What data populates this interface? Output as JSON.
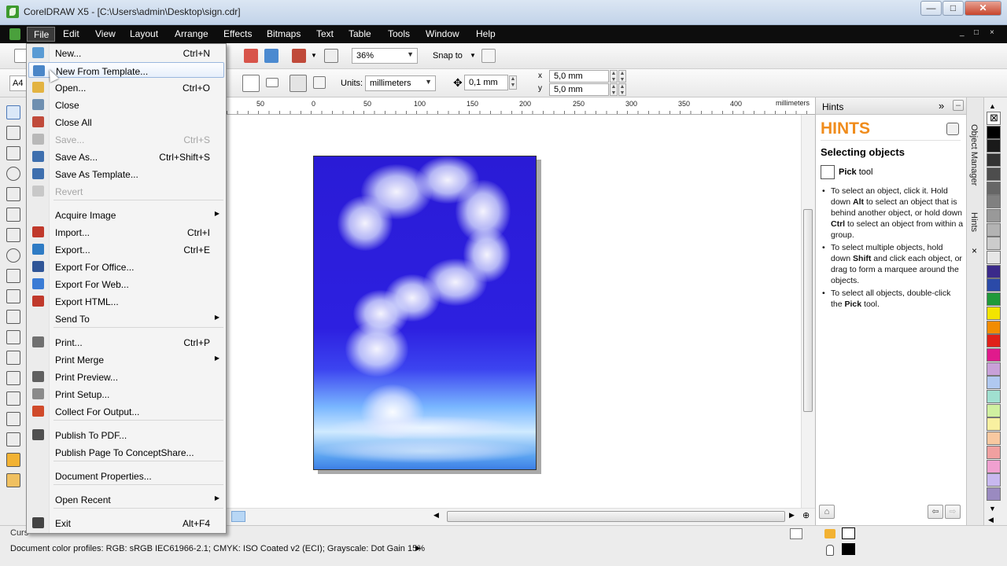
{
  "window": {
    "title": "CorelDRAW X5 - [C:\\Users\\admin\\Desktop\\sign.cdr]",
    "minimize": "—",
    "maximize": "□",
    "close": "✕"
  },
  "menubar": {
    "items": [
      "File",
      "Edit",
      "View",
      "Layout",
      "Arrange",
      "Effects",
      "Bitmaps",
      "Text",
      "Table",
      "Tools",
      "Window",
      "Help"
    ],
    "mdi": [
      "_",
      "□",
      "×"
    ]
  },
  "toolbar1": {
    "zoom": "36%",
    "snap_to": "Snap to"
  },
  "toolbar2": {
    "paper": "A4",
    "units_label": "Units:",
    "units_value": "millimeters",
    "nudge": "0,1 mm",
    "dup_x": "5,0 mm",
    "dup_y": "5,0 mm",
    "x_icon": "x",
    "y_icon": "y"
  },
  "ruler": {
    "ticks": [
      "50",
      "0",
      "50",
      "100",
      "150",
      "200",
      "250",
      "300",
      "350",
      "400"
    ],
    "unit": "millimeters"
  },
  "file_menu": [
    {
      "label": "New...",
      "shortcut": "Ctrl+N",
      "icon": "new-document-icon",
      "color": "#5a9bd4"
    },
    {
      "label": "New From Template...",
      "shortcut": "",
      "icon": "template-icon",
      "color": "#4a86c8",
      "highlight": true
    },
    {
      "label": "Open...",
      "shortcut": "Ctrl+O",
      "icon": "open-folder-icon",
      "color": "#e3b341"
    },
    {
      "label": "Close",
      "shortcut": "",
      "icon": "close-document-icon",
      "color": "#6f8fb0"
    },
    {
      "label": "Close All",
      "shortcut": "",
      "icon": "close-all-icon",
      "color": "#c04a3a"
    },
    {
      "label": "Save...",
      "shortcut": "Ctrl+S",
      "icon": "save-icon",
      "color": "#b8b8b8",
      "disabled": true
    },
    {
      "label": "Save As...",
      "shortcut": "Ctrl+Shift+S",
      "icon": "save-as-icon",
      "color": "#3e6fae"
    },
    {
      "label": "Save As Template...",
      "shortcut": "",
      "icon": "save-template-icon",
      "color": "#3e6fae"
    },
    {
      "label": "Revert",
      "shortcut": "",
      "icon": "revert-icon",
      "color": "#c8c8c8",
      "disabled": true
    },
    {
      "label": "Acquire Image",
      "shortcut": "",
      "icon": "",
      "submenu": true
    },
    {
      "label": "Import...",
      "shortcut": "Ctrl+I",
      "icon": "import-icon",
      "color": "#c0392b"
    },
    {
      "label": "Export...",
      "shortcut": "Ctrl+E",
      "icon": "export-icon",
      "color": "#2e7bc4"
    },
    {
      "label": "Export For Office...",
      "shortcut": "",
      "icon": "export-office-icon",
      "color": "#2f5597"
    },
    {
      "label": "Export For Web...",
      "shortcut": "",
      "icon": "export-web-icon",
      "color": "#3a7bd5"
    },
    {
      "label": "Export HTML...",
      "shortcut": "",
      "icon": "export-html-icon",
      "color": "#c0392b"
    },
    {
      "label": "Send To",
      "shortcut": "",
      "icon": "",
      "submenu": true
    },
    {
      "label": "Print...",
      "shortcut": "Ctrl+P",
      "icon": "print-icon",
      "color": "#707070"
    },
    {
      "label": "Print Merge",
      "shortcut": "",
      "icon": "",
      "submenu": true
    },
    {
      "label": "Print Preview...",
      "shortcut": "",
      "icon": "print-preview-icon",
      "color": "#606060"
    },
    {
      "label": "Print Setup...",
      "shortcut": "",
      "icon": "print-setup-icon",
      "color": "#8a8a8a"
    },
    {
      "label": "Collect For Output...",
      "shortcut": "",
      "icon": "collect-output-icon",
      "color": "#d04a2a"
    },
    {
      "label": "Publish To PDF...",
      "shortcut": "",
      "icon": "pdf-icon",
      "color": "#505050"
    },
    {
      "label": "Publish Page To ConceptShare...",
      "shortcut": "",
      "icon": ""
    },
    {
      "label": "Document Properties...",
      "shortcut": "",
      "icon": ""
    },
    {
      "label": "Open Recent",
      "shortcut": "",
      "icon": "",
      "submenu": true
    },
    {
      "label": "Exit",
      "shortcut": "Alt+F4",
      "icon": "exit-icon",
      "color": "#444444"
    }
  ],
  "hints": {
    "docker_title": "Hints",
    "logo": "HINTS",
    "heading": "Selecting objects",
    "tool_name": "Pick",
    "tool_suffix": " tool",
    "items": [
      "To select an object, click it. Hold down <b>Alt</b> to select an object that is behind another object, or hold down <b>Ctrl</b> to select an object from within a group.",
      "To select multiple objects, hold down <b>Shift</b> and click each object, or drag to form a marquee around the objects.",
      "To select all objects, double-click the <b>Pick</b> tool."
    ]
  },
  "docker_tabs": [
    "Object Manager",
    "Hints"
  ],
  "palette": [
    "#ffffff",
    "#000000",
    "#1a1a1a",
    "#333333",
    "#4d4d4d",
    "#666666",
    "#808080",
    "#999999",
    "#b3b3b3",
    "#cccccc",
    "#e6e6e6",
    "#3b2a8a",
    "#2b4aa8",
    "#1f9a3a",
    "#f2e400",
    "#f28c00",
    "#e0201a",
    "#e01a8c",
    "#c8a0d8",
    "#b0c8f0",
    "#a0e0d0",
    "#d0f0a0",
    "#f8f0a0",
    "#f8c8a0",
    "#f0a0a0",
    "#f0a0d0",
    "#c8b8f0",
    "#9a8ac0"
  ],
  "status": {
    "cursor": "Curs",
    "profiles": "Document color profiles: RGB: sRGB IEC61966-2.1; CMYK: ISO Coated v2 (ECI); Grayscale: Dot Gain 15%"
  }
}
